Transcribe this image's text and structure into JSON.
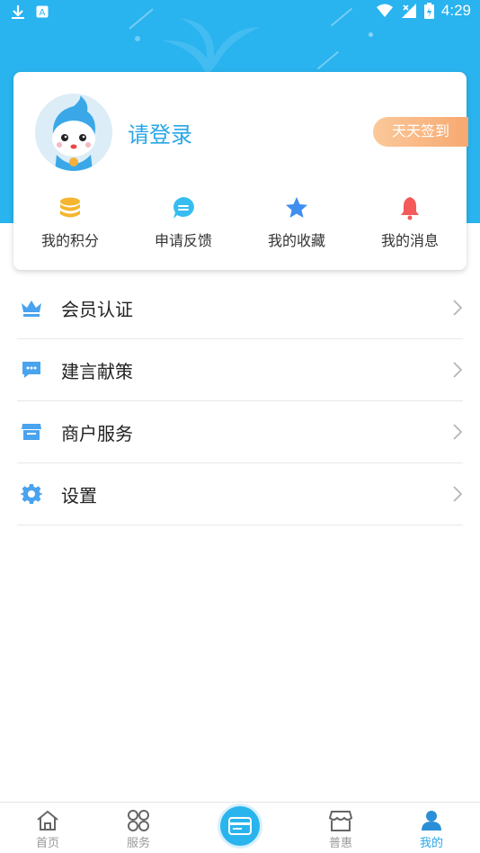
{
  "status_bar": {
    "time": "4:29"
  },
  "profile": {
    "login_prompt": "请登录",
    "signin_label": "天天签到"
  },
  "quick_actions": [
    {
      "label": "我的积分",
      "icon": "coins-icon",
      "color": "#f5b52e"
    },
    {
      "label": "申请反馈",
      "icon": "chat-bubble-icon",
      "color": "#36bdf0"
    },
    {
      "label": "我的收藏",
      "icon": "star-icon",
      "color": "#3f8ef0"
    },
    {
      "label": "我的消息",
      "icon": "bell-icon",
      "color": "#f45a5a"
    }
  ],
  "menu": [
    {
      "label": "会员认证",
      "icon": "crown-icon"
    },
    {
      "label": "建言献策",
      "icon": "message-icon"
    },
    {
      "label": "商户服务",
      "icon": "store-icon"
    },
    {
      "label": "设置",
      "icon": "gear-icon"
    }
  ],
  "tabbar": [
    {
      "label": "首页",
      "icon": "home-icon",
      "active": false
    },
    {
      "label": "服务",
      "icon": "grid-icon",
      "active": false
    },
    {
      "label": "",
      "icon": "card-icon",
      "active": false
    },
    {
      "label": "普惠",
      "icon": "shop-icon",
      "active": false
    },
    {
      "label": "我的",
      "icon": "user-icon",
      "active": true
    }
  ],
  "colors": {
    "accent": "#29b3ef",
    "active_tab": "#29a6e8",
    "signin_gradient_start": "#fbc89a",
    "signin_gradient_end": "#f7a970"
  }
}
